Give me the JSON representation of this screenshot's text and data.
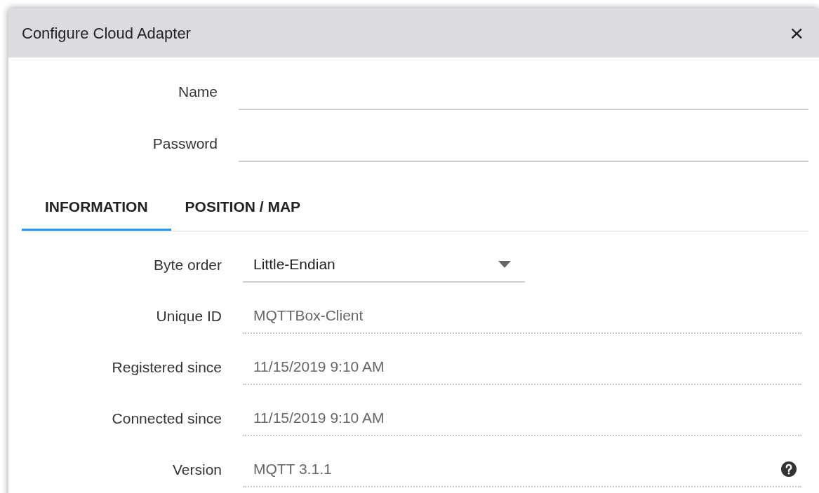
{
  "dialog": {
    "title": "Configure Cloud Adapter",
    "close": "×"
  },
  "fields": [
    {
      "label": "Name"
    },
    {
      "label": "Password"
    }
  ],
  "tabs": [
    {
      "label": "INFORMATION",
      "selected": true
    },
    {
      "label": "POSITION / MAP",
      "selected": false
    }
  ],
  "info_rows": [
    {
      "kind": "select",
      "label": "Byte order",
      "value": "Little-Endian"
    },
    {
      "kind": "readonly",
      "label": "Unique ID",
      "value": "MQTTBox-Client",
      "help": false
    },
    {
      "kind": "readonly",
      "label": "Registered since",
      "value": "11/15/2019 9:10 AM",
      "help": false
    },
    {
      "kind": "readonly",
      "label": "Connected since",
      "value": "11/15/2019 9:10 AM",
      "help": false
    },
    {
      "kind": "readonly",
      "label": "Version",
      "value": "MQTT 3.1.1",
      "help": true
    }
  ]
}
